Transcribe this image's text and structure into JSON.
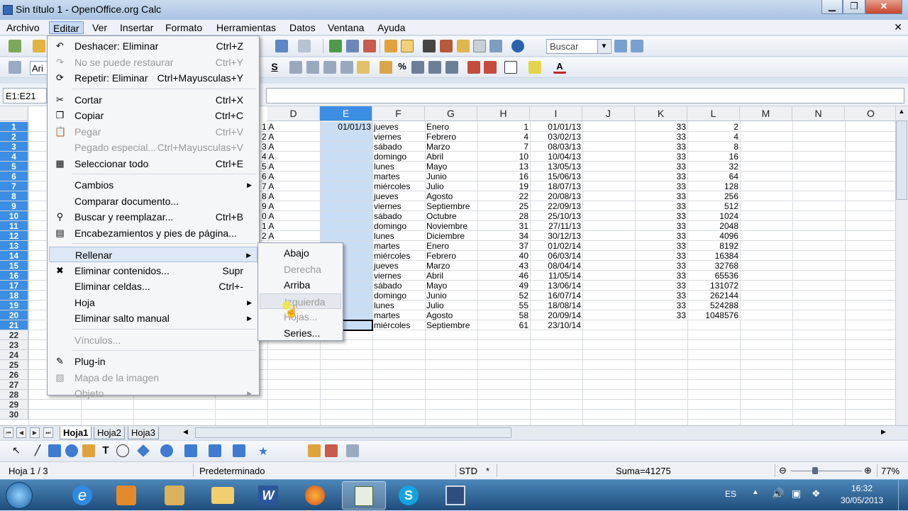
{
  "window": {
    "title": "Sin título 1 - OpenOffice.org Calc",
    "minimize": "▁",
    "restore": "❐",
    "close": "✕"
  },
  "menubar": [
    "Archivo",
    "Editar",
    "Ver",
    "Insertar",
    "Formato",
    "Herramientas",
    "Datos",
    "Ventana",
    "Ayuda"
  ],
  "menubar_close": "✕",
  "toolbar": {
    "search_placeholder": "Buscar",
    "font_partial": "Ari"
  },
  "namebox": "E1:E21",
  "columns": [
    "D",
    "E",
    "F",
    "G",
    "H",
    "I",
    "J",
    "K",
    "L",
    "M",
    "N",
    "O"
  ],
  "rows": [
    "1",
    "2",
    "3",
    "4",
    "5",
    "6",
    "7",
    "8",
    "9",
    "10",
    "11",
    "12",
    "13",
    "14",
    "15",
    "16",
    "17",
    "18",
    "19",
    "20",
    "21",
    "22",
    "23",
    "24",
    "25",
    "26",
    "27",
    "28",
    "29",
    "30"
  ],
  "col_c_partial": [
    "1 A",
    "2 A",
    "3 A",
    "4 A",
    "5 A",
    "6 A",
    "7 A",
    "8 A",
    "9 A",
    "0 A",
    "1 A",
    "2 A"
  ],
  "col_e": [
    "01/01/13"
  ],
  "col_f": [
    "jueves",
    "viernes",
    "sábado",
    "domingo",
    "lunes",
    "martes",
    "miércoles",
    "jueves",
    "viernes",
    "sábado",
    "domingo",
    "lunes",
    "martes",
    "miércoles",
    "jueves",
    "viernes",
    "sábado",
    "domingo",
    "lunes",
    "martes",
    "miércoles"
  ],
  "col_g": [
    "Enero",
    "Febrero",
    "Marzo",
    "Abril",
    "Mayo",
    "Junio",
    "Julio",
    "Agosto",
    "Septiembre",
    "Octubre",
    "Noviembre",
    "Diciembre",
    "Enero",
    "Febrero",
    "Marzo",
    "Abril",
    "Mayo",
    "Junio",
    "Julio",
    "Agosto",
    "Septiembre"
  ],
  "col_h": [
    "1",
    "4",
    "7",
    "10",
    "13",
    "16",
    "19",
    "22",
    "25",
    "28",
    "31",
    "34",
    "37",
    "40",
    "43",
    "46",
    "49",
    "52",
    "55",
    "58",
    "61"
  ],
  "col_i": [
    "01/01/13",
    "03/02/13",
    "08/03/13",
    "10/04/13",
    "13/05/13",
    "15/06/13",
    "18/07/13",
    "20/08/13",
    "22/09/13",
    "25/10/13",
    "27/11/13",
    "30/12/13",
    "01/02/14",
    "06/03/14",
    "08/04/14",
    "11/05/14",
    "13/06/14",
    "16/07/14",
    "18/08/14",
    "20/09/14",
    "23/10/14"
  ],
  "col_k": [
    "33",
    "33",
    "33",
    "33",
    "33",
    "33",
    "33",
    "33",
    "33",
    "33",
    "33",
    "33",
    "33",
    "33",
    "33",
    "33",
    "33",
    "33",
    "33",
    "33"
  ],
  "col_l": [
    "2",
    "4",
    "8",
    "16",
    "32",
    "64",
    "128",
    "256",
    "512",
    "1024",
    "2048",
    "4096",
    "8192",
    "16384",
    "32768",
    "65536",
    "131072",
    "262144",
    "524288",
    "1048576"
  ],
  "edit_menu": [
    {
      "label": "Deshacer: Eliminar",
      "shortcut": "Ctrl+Z",
      "icon": "↶",
      "disabled": false
    },
    {
      "label": "No se puede restaurar",
      "shortcut": "Ctrl+Y",
      "icon": "↷",
      "disabled": true
    },
    {
      "label": "Repetir: Eliminar",
      "shortcut": "Ctrl+Mayusculas+Y",
      "icon": "⟳",
      "disabled": false
    },
    {
      "label": "Cortar",
      "shortcut": "Ctrl+X",
      "icon": "✂",
      "disabled": false
    },
    {
      "label": "Copiar",
      "shortcut": "Ctrl+C",
      "icon": "❐",
      "disabled": false
    },
    {
      "label": "Pegar",
      "shortcut": "Ctrl+V",
      "icon": "📋",
      "disabled": true
    },
    {
      "label": "Pegado especial...",
      "shortcut": "Ctrl+Mayusculas+V",
      "icon": "",
      "disabled": true
    },
    {
      "label": "Seleccionar todo",
      "shortcut": "Ctrl+E",
      "icon": "▦",
      "disabled": false
    },
    {
      "label": "Cambios",
      "shortcut": "",
      "icon": "",
      "disabled": false,
      "submenu": true
    },
    {
      "label": "Comparar documento...",
      "shortcut": "",
      "icon": "",
      "disabled": false
    },
    {
      "label": "Buscar y reemplazar...",
      "shortcut": "Ctrl+B",
      "icon": "⚲",
      "disabled": false
    },
    {
      "label": "Encabezamientos y pies de página...",
      "shortcut": "",
      "icon": "▤",
      "disabled": false
    },
    {
      "label": "Rellenar",
      "shortcut": "",
      "icon": "",
      "disabled": false,
      "submenu": true
    },
    {
      "label": "Eliminar contenidos...",
      "shortcut": "Supr",
      "icon": "✖",
      "disabled": false
    },
    {
      "label": "Eliminar celdas...",
      "shortcut": "Ctrl+-",
      "icon": "",
      "disabled": false
    },
    {
      "label": "Hoja",
      "shortcut": "",
      "icon": "",
      "disabled": false,
      "submenu": true
    },
    {
      "label": "Eliminar salto manual",
      "shortcut": "",
      "icon": "",
      "disabled": false,
      "submenu": true
    },
    {
      "label": "Vínculos...",
      "shortcut": "",
      "icon": "",
      "disabled": true
    },
    {
      "label": "Plug-in",
      "shortcut": "",
      "icon": "✎",
      "disabled": false
    },
    {
      "label": "Mapa de la imagen",
      "shortcut": "",
      "icon": "▧",
      "disabled": true
    },
    {
      "label": "Objeto",
      "shortcut": "",
      "icon": "",
      "disabled": true,
      "submenu": true
    }
  ],
  "fill_submenu": [
    {
      "label": "Abajo",
      "disabled": false
    },
    {
      "label": "Derecha",
      "disabled": true
    },
    {
      "label": "Arriba",
      "disabled": false
    },
    {
      "label": "Izquierda",
      "disabled": true
    },
    {
      "label": "Hojas...",
      "disabled": true
    },
    {
      "label": "Series...",
      "disabled": false
    }
  ],
  "sheet_tabs": [
    "Hoja1",
    "Hoja2",
    "Hoja3"
  ],
  "status": {
    "sheet": "Hoja 1 / 3",
    "style": "Predeterminado",
    "mode": "STD",
    "modified": "*",
    "sum": "Suma=41275",
    "zoom": "77%"
  },
  "taskbar": {
    "lang": "ES",
    "time": "16:32",
    "date": "30/05/2013"
  }
}
